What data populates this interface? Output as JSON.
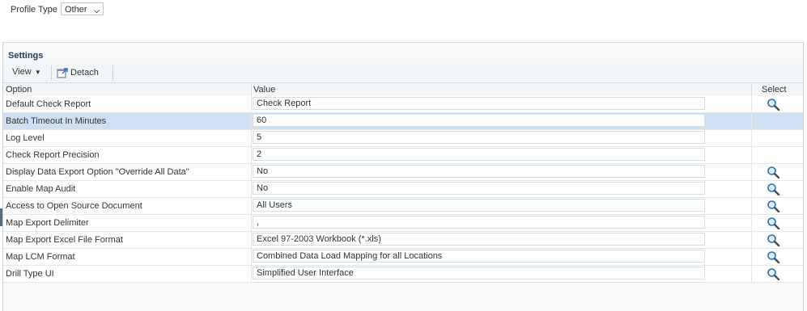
{
  "profile": {
    "label": "Profile Type",
    "selected": "Other"
  },
  "panel": {
    "title": "Settings"
  },
  "toolbar": {
    "view_label": "View",
    "detach_label": "Detach"
  },
  "columns": {
    "option": "Option",
    "value": "Value",
    "select": "Select"
  },
  "rows": [
    {
      "option": "Default Check Report",
      "value": "Check Report",
      "has_select": true,
      "selected": false
    },
    {
      "option": "Batch Timeout In Minutes",
      "value": "60",
      "has_select": false,
      "selected": true
    },
    {
      "option": "Log Level",
      "value": "5",
      "has_select": false,
      "selected": false
    },
    {
      "option": "Check Report Precision",
      "value": "2",
      "has_select": false,
      "selected": false
    },
    {
      "option": "Display Data Export Option \"Override All Data\"",
      "value": "No",
      "has_select": true,
      "selected": false
    },
    {
      "option": "Enable Map Audit",
      "value": "No",
      "has_select": true,
      "selected": false
    },
    {
      "option": "Access to Open Source Document",
      "value": "All Users",
      "has_select": true,
      "selected": false
    },
    {
      "option": "Map Export Delimiter",
      "value": ",",
      "has_select": true,
      "selected": false
    },
    {
      "option": "Map Export Excel File Format",
      "value": "Excel 97-2003 Workbook (*.xls)",
      "has_select": true,
      "selected": false
    },
    {
      "option": "Map LCM Format",
      "value": "Combined Data Load Mapping for all Locations",
      "has_select": true,
      "selected": false
    },
    {
      "option": "Drill Type UI",
      "value": "Simplified User Interface",
      "has_select": true,
      "selected": false
    }
  ],
  "colors": {
    "selected_row": "#cfe0f2",
    "title": "#1f3a5a",
    "icon_blue": "#2a6fb8"
  },
  "icons": {
    "select": "search-icon",
    "detach": "detach-icon",
    "view_caret": "caret-down-icon",
    "profile_chevron": "chevron-down-icon"
  }
}
